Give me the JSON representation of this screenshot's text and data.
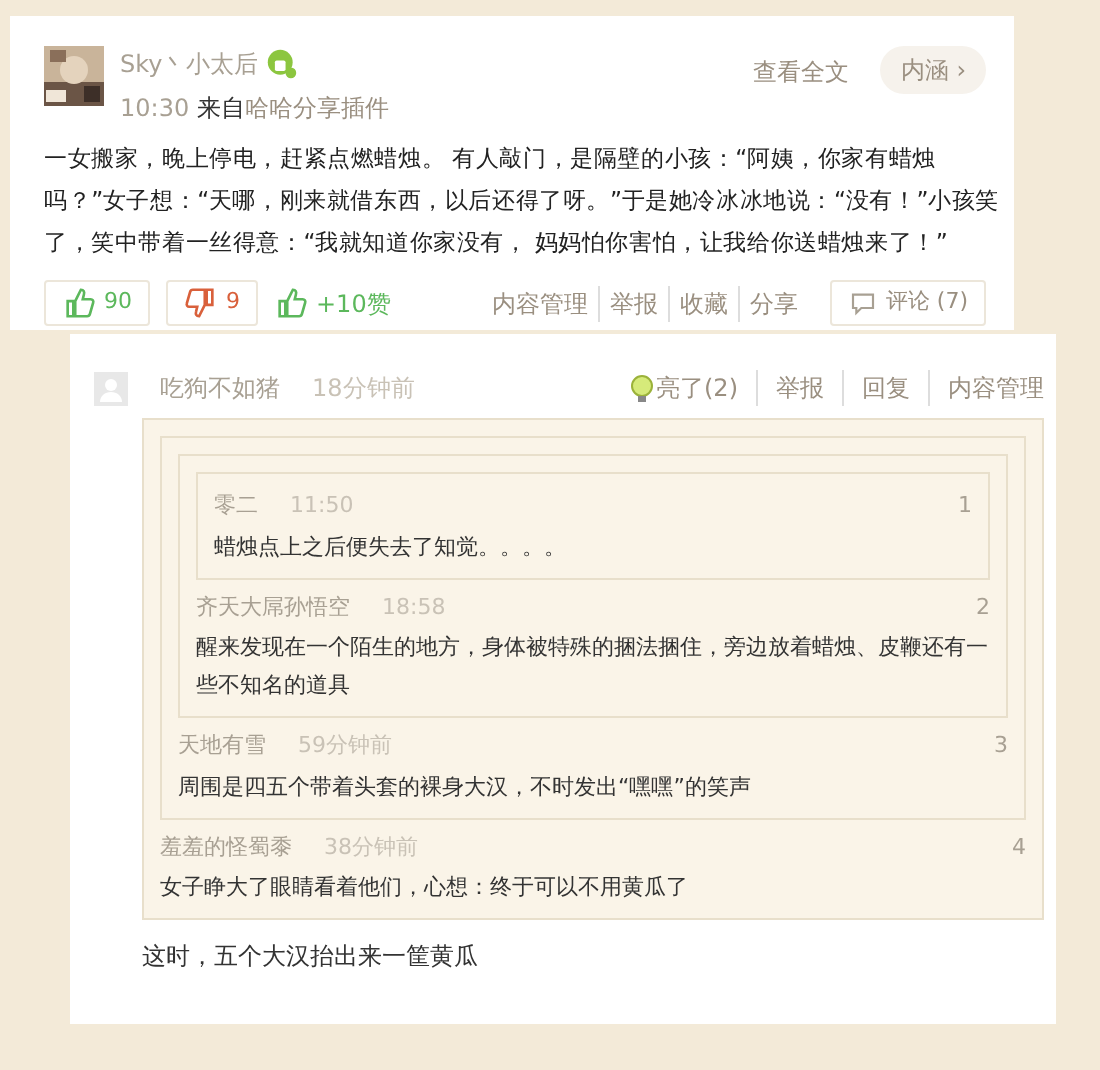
{
  "post": {
    "author": "Sky丶小太后",
    "time": "10:30",
    "source_prefix": "来自",
    "source": "哈哈分享插件",
    "view_full": "查看全文",
    "category": "内涵 ›",
    "text": "一女搬家，晚上停电，赶紧点燃蜡烛。 有人敲门，是隔壁的小孩：“阿姨，你家有蜡烛吗？”女子想：“天哪，刚来就借东西，以后还得了呀。”于是她冷冰冰地说：“没有！”小孩笑了，笑中带着一丝得意：“我就知道你家没有， 妈妈怕你害怕，让我给你送蜡烛来了！”",
    "votes": [
      {
        "kind": "up",
        "count": "90"
      },
      {
        "kind": "down",
        "count": "9"
      },
      {
        "kind": "plus",
        "count": "+10赞"
      }
    ],
    "actions": [
      "内容管理",
      "举报",
      "收藏",
      "分享"
    ],
    "comment_button": "评论 (7)"
  },
  "comment": {
    "author": "吃狗不如猪",
    "time": "18分钟前",
    "likes": "亮了(2)",
    "actions": [
      "举报",
      "回复",
      "内容管理"
    ],
    "quote": {
      "author": "羞羞的怪蜀黍",
      "time": "38分钟前",
      "floor": "4",
      "text": "女子睁大了眼睛看着他们，心想：终于可以不用黄瓜了",
      "quote": {
        "author": "天地有雪",
        "time": "59分钟前",
        "floor": "3",
        "text": "周围是四五个带着头套的裸身大汉，不时发出“嘿嘿”的笑声",
        "quote": {
          "author": "齐天大屌孙悟空",
          "time": "18:58",
          "floor": "2",
          "text": "醒来发现在一个陌生的地方，身体被特殊的捆法捆住，旁边放着蜡烛、皮鞭还有一些不知名的道具",
          "quote": {
            "author": "零二",
            "time": "11:50",
            "floor": "1",
            "text": "蜡烛点上之后便失去了知觉。。。。"
          }
        }
      }
    },
    "text": "这时，五个大汉抬出来一筐黄瓜"
  }
}
